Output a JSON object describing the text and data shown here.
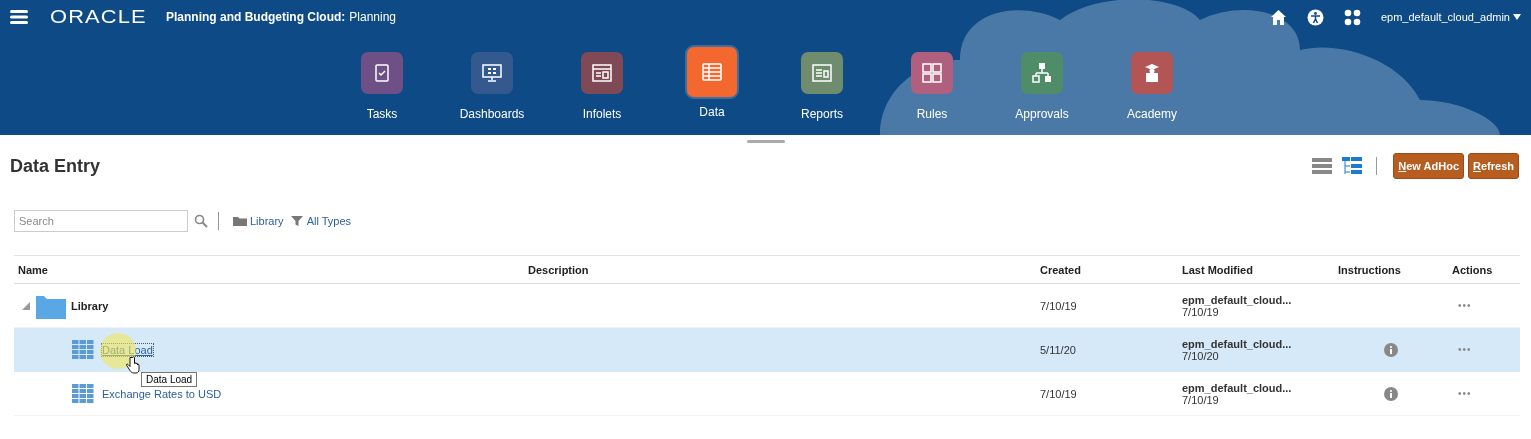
{
  "header": {
    "logo": "ORACLE",
    "app_title": "Planning and Budgeting Cloud:",
    "app_subtitle": "Planning",
    "user": "epm_default_cloud_admin"
  },
  "nav": [
    {
      "label": "Tasks",
      "kind": "tasks",
      "color": "#6e4f86",
      "selected": false
    },
    {
      "label": "Dashboards",
      "kind": "dashboards",
      "color": "#34598f",
      "selected": false
    },
    {
      "label": "Infolets",
      "kind": "infolets",
      "color": "#7f4a55",
      "selected": false
    },
    {
      "label": "Data",
      "kind": "data",
      "color": "#f4682f",
      "selected": true
    },
    {
      "label": "Reports",
      "kind": "reports",
      "color": "#6f8c6f",
      "selected": false
    },
    {
      "label": "Rules",
      "kind": "rules",
      "color": "#b0607e",
      "selected": false
    },
    {
      "label": "Approvals",
      "kind": "approvals",
      "color": "#4f8c68",
      "selected": false
    },
    {
      "label": "Academy",
      "kind": "academy",
      "color": "#b35555",
      "selected": false
    }
  ],
  "page": {
    "title": "Data Entry",
    "buttons": [
      {
        "label": "New AdHoc"
      },
      {
        "label": "Refresh"
      }
    ]
  },
  "toolbar": {
    "search_placeholder": "Search",
    "library": "Library",
    "filter": "All Types"
  },
  "table": {
    "columns": [
      "Name",
      "Description",
      "Created",
      "Last Modified",
      "Instructions",
      "Actions"
    ],
    "rows": [
      {
        "kind": "folder",
        "name": "Library",
        "expanded": true,
        "selected": false,
        "created": "7/10/19",
        "modified_by": "epm_default_cloud...",
        "modified": "7/10/19",
        "instructions": false,
        "actions": "•••",
        "children": [
          {
            "kind": "form",
            "name": "Data Load",
            "selected": true,
            "created": "5/11/20",
            "modified_by": "epm_default_cloud...",
            "modified": "7/10/20",
            "instructions": true,
            "actions": "•••"
          },
          {
            "kind": "form",
            "name": "Exchange Rates to USD",
            "selected": false,
            "created": "7/10/19",
            "modified_by": "epm_default_cloud...",
            "modified": "7/10/19",
            "instructions": true,
            "actions": "•••"
          }
        ]
      }
    ]
  },
  "tooltip": "Data Load"
}
